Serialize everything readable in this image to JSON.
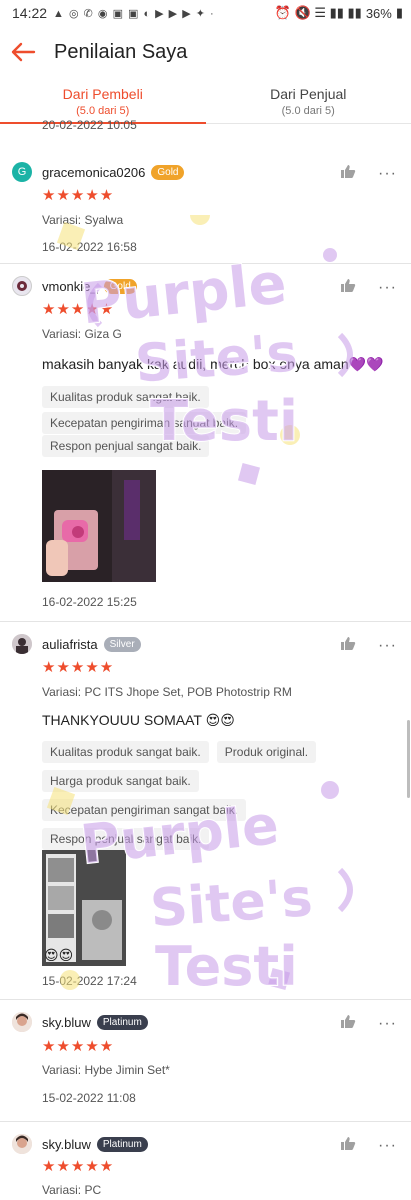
{
  "status_bar": {
    "time": "14:22",
    "left_icons": "▲ ◎ ✆ ◉ ▣ ▣ ◐ ▶ ▶ ▶ ✦ ·",
    "battery": "36%",
    "right_icons": "⏰ 🔇 ☰ ▮▮ ▮▮"
  },
  "app_bar": {
    "title": "Penilaian Saya"
  },
  "tabs": [
    {
      "label": "Dari Pembeli",
      "sub": "(5.0 dari 5)"
    },
    {
      "label": "Dari Penjual",
      "sub": "(5.0 dari 5)"
    }
  ],
  "top_fragment_date": "20-02-2022 10:05",
  "stars_text": "★★★★★",
  "reviews": [
    {
      "avatar_letter": "G",
      "username": "gracemonica0206",
      "badge": "Gold",
      "variant": "Variasi: Syalwa",
      "date": "16-02-2022 16:58"
    },
    {
      "avatar_letter": "",
      "username": "vmonkie_",
      "badge": "Gold",
      "variant": "Variasi: Giza G",
      "comment": "makasih banyak kak audii, merch box onya aman💜💜",
      "tags": [
        "Kualitas produk sangat baik.",
        "Kecepatan pengiriman sangat baik.",
        "Respon penjual sangat baik."
      ],
      "date": "16-02-2022 15:25"
    },
    {
      "avatar_letter": "",
      "username": "auliafrista",
      "badge": "Silver",
      "variant": "Variasi: PC ITS Jhope Set, POB Photostrip RM",
      "comment": "THANKYOUUU SOMAAT 😍😍",
      "tags": [
        "Kualitas produk sangat baik.",
        "Produk original.",
        "Harga produk sangat baik.",
        "Kecepatan pengiriman sangat baik.",
        "Respon penjual sangat baik."
      ],
      "photo_emoji": "😍😍",
      "date": "15-02-2022 17:24"
    },
    {
      "avatar_letter": "",
      "username": "sky.bluw",
      "badge": "Platinum",
      "variant": "Variasi: Hybe Jimin Set*",
      "date": "15-02-2022 11:08"
    },
    {
      "avatar_letter": "",
      "username": "sky.bluw",
      "badge": "Platinum",
      "variant": "Variasi: PC"
    }
  ],
  "watermark": {
    "line1": "Purple",
    "line2": "Site's",
    "line3": "Testi"
  },
  "colors": {
    "accent": "#ee4d2d",
    "gold": "#f0a32a",
    "silver": "#a9aeb8",
    "platinum": "#3a3f4e",
    "watermark": "#c79be8"
  }
}
